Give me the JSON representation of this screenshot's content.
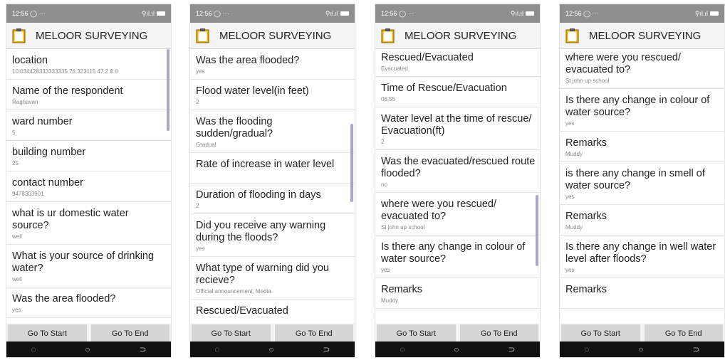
{
  "app_title": "MELOOR SURVEYING",
  "buttons": {
    "start": "Go To Start",
    "end": "Go To End"
  },
  "nav": {
    "back": "◌",
    "home": "○",
    "recent": "⊃"
  },
  "accent_scrollbar": "#a7a7c6",
  "screens": [
    {
      "time": "12:56 ◯ ···",
      "signal": "⚲ıl.ıl",
      "items": [
        {
          "q": "location",
          "a": "10.034428333333335 76.323115 47.2 8.6"
        },
        {
          "q": "Name of the respondent",
          "a": "Raghavan"
        },
        {
          "q": "ward number",
          "a": "5"
        },
        {
          "q": "building number",
          "a": "25"
        },
        {
          "q": "contact number",
          "a": "9478303901"
        },
        {
          "q": "what is ur domestic water source?",
          "a": "well"
        },
        {
          "q": "What is your source of drinking water?",
          "a": "well"
        },
        {
          "q": "Was the area flooded?",
          "a": "yes"
        }
      ]
    },
    {
      "time": "12:56 ◯ ···",
      "signal": "⚲ıl.ıl",
      "items": [
        {
          "q": "Was the area flooded?",
          "a": "yes"
        },
        {
          "q": "Flood water level(in feet)",
          "a": "2"
        },
        {
          "q": "Was the flooding sudden/gradual?",
          "a": "Gradual"
        },
        {
          "q": "Rate of increase in water level",
          "a": ""
        },
        {
          "q": "Duration of flooding in days",
          "a": "2"
        },
        {
          "q": "Did you receive any warning during the floods?",
          "a": "yes"
        },
        {
          "q": "What type of warning did you recieve?",
          "a": "Official announcement, Media"
        },
        {
          "q": "Rescued/Evacuated",
          "a": ""
        }
      ]
    },
    {
      "time": "12:56 ◯ ···",
      "signal": "⚲ıl.ıl",
      "items": [
        {
          "q": "Rescued/Evacuated",
          "a": "Evacuated"
        },
        {
          "q": "Time of Rescue/Evacuation",
          "a": "06:55"
        },
        {
          "q": "Water level at the time of rescue/ Evacuation(ft)",
          "a": "2"
        },
        {
          "q": "Was the evacuated/rescued route flooded?",
          "a": "no"
        },
        {
          "q": "where were you rescued/ evacuated to?",
          "a": "St john up school"
        },
        {
          "q": "Is there any change in colour of water source?",
          "a": "yes"
        },
        {
          "q": "Remarks",
          "a": "Muddy"
        }
      ]
    },
    {
      "time": "12:56 ◯ ···",
      "signal": "⚲ıl.ıl",
      "items": [
        {
          "q": "where were you rescued/ evacuated to?",
          "a": "St john up school"
        },
        {
          "q": "Is there any change in colour of water source?",
          "a": "yes"
        },
        {
          "q": "Remarks",
          "a": "Muddy"
        },
        {
          "q": "is there any change in smell of water source?",
          "a": "yes"
        },
        {
          "q": "Remarks",
          "a": "Muddy"
        },
        {
          "q": "Is there any change in well water level after floods?",
          "a": "yes"
        },
        {
          "q": "Remarks",
          "a": ""
        }
      ]
    }
  ]
}
